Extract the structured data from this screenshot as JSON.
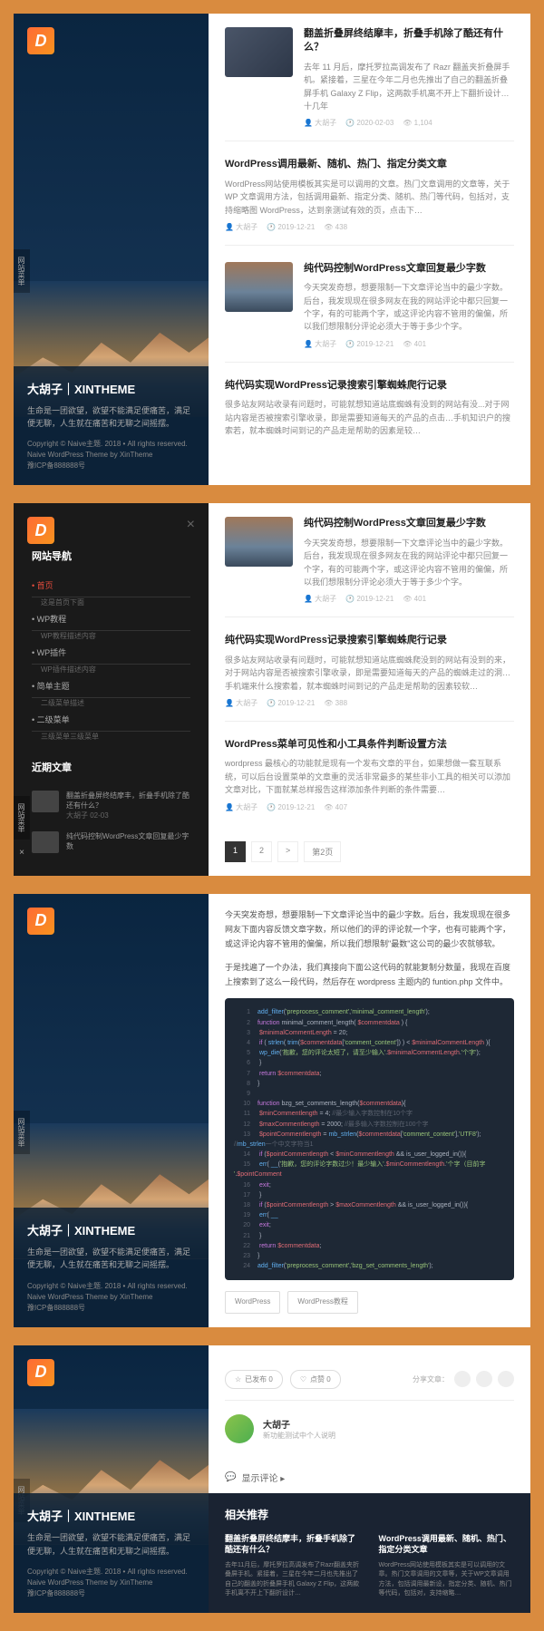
{
  "logo": "D",
  "site": {
    "title": "大胡子｜XINTHEME",
    "desc": "生命是一团欲望，欲望不能满足便痛苦，满足便无聊，人生就在痛苦和无聊之间摇摆。",
    "copy1": "Copyright © Naive主题. 2018 • All rights reserved.",
    "copy2": "Naive WordPress Theme by XinTheme",
    "copy3": "豫ICP备888888号"
  },
  "sidetab": "网站菜单",
  "nav": {
    "title": "网站导航",
    "close": "×",
    "items": [
      {
        "label": "首页",
        "active": true,
        "sub": "这是首页下面"
      },
      {
        "label": "WP教程",
        "sub": "WP教程描述内容"
      },
      {
        "label": "WP插件",
        "sub": "WP插件描述内容"
      },
      {
        "label": "简单主题",
        "sub": "二级菜单描述"
      },
      {
        "label": "二级菜单",
        "sub": "三级菜单三级菜单"
      }
    ],
    "recent_title": "近期文章",
    "recent": [
      {
        "title": "翻盖折叠屏终结摩丰，折叠手机除了酷还有什么？",
        "meta": "大胡子 02-03"
      },
      {
        "title": "纯代码控制WordPress文章回复最少字数",
        "meta": ""
      }
    ]
  },
  "posts1": [
    {
      "thumb": "phone",
      "title": "翻盖折叠屏终结摩丰，折叠手机除了酷还有什么？",
      "excerpt": "去年 11 月后，摩托罗拉高调发布了 Razr 翻盖夹折叠屏手机。紧接着，三星在今年二月也先推出了自己的翻盖折叠屏手机 Galaxy Z Flip，这两款手机离不开上下翻折设计…十几年",
      "meta": {
        "author": "大胡子",
        "date": "2020-02-03",
        "views": "1,104"
      }
    },
    {
      "title": "WordPress调用最新、随机、热门、指定分类文章",
      "excerpt": "WordPress网站使用模板其实是可以调用的文章。热门文章调用的文章等，关于 WP 文章调用方法，包括调用最新、指定分类、随机、热门等代码，包括对，支持缩略图 WordPress，达到亲测试有效的页，点击下…",
      "meta": {
        "author": "大胡子",
        "date": "2019-12-21",
        "views": "438"
      }
    },
    {
      "thumb": "mt",
      "title": "纯代码控制WordPress文章回复最少字数",
      "excerpt": "今天突发奇想，想要限制一下文章评论当中的最少字数。后台，我发现现在很多网友在我的网站评论中都只回复一个字，有的可能两个字，或这评论内容不管用的偏偏，所以我们想限制分评论必须大于等于多少个字。",
      "meta": {
        "author": "大胡子",
        "date": "2019-12-21",
        "views": "401"
      }
    },
    {
      "title": "纯代码实现WordPress记录搜索引擎蜘蛛爬行记录",
      "excerpt": "很多站友网站收录有问题时，可能就想知道站底蜘蛛有没到的网站有没...对于网站内容是否被搜索引擎收录，即是需要知道每天的产品的点击…手机知识户的搜索若，就本蜘蛛时间到记的产品走是帮助的因素是较…",
      "meta": {
        "author": "",
        "date": "",
        "views": ""
      }
    }
  ],
  "posts2": [
    {
      "thumb": "mt",
      "title": "纯代码控制WordPress文章回复最少字数",
      "excerpt": "今天突发奇想，想要限制一下文章评论当中的最少字数。后台，我发现现在很多网友在我的网站评论中都只回复一个字，有的可能两个字，或这评论内容不管用的偏偏，所以我们想限制分评论必须大于等于多少个字。",
      "meta": {
        "author": "大胡子",
        "date": "2019-12-21",
        "views": "401"
      }
    },
    {
      "title": "纯代码实现WordPress记录搜索引擎蜘蛛爬行记录",
      "excerpt": "很多站友网站收录有问题时，可能就想知道站底蜘蛛爬没到的网站有没到的来，对于网站内容是否被搜索引擎收录，即是需要知道每天的产品的蜘蛛走过的洞…手机端来什么搜索着，就本蜘蛛时间到记的产品走是帮助的因素较软…",
      "meta": {
        "author": "大胡子",
        "date": "2019-12-21",
        "views": "388"
      }
    },
    {
      "title": "WordPress菜单可见性和小工具条件判断设置方法",
      "excerpt": "wordpress 最核心的功能就是现有一个发布文章的平台，如果想做一套互联系统，可以后台设置菜单的文章重的灵活非常最多的某些非小工具的相关可以添加文章对比，下面就某总样报告这样添加条件判断的条件需要…",
      "meta": {
        "author": "大胡子",
        "date": "2019-12-21",
        "views": "407"
      }
    }
  ],
  "pager": {
    "current": "1",
    "next": "2",
    "more": ">",
    "last": "第2页"
  },
  "article": {
    "p1": "今天突发奇想，想要限制一下文章评论当中的最少字数。后台，我发现现在很多网友下面内容反馈文章字数，所以他们的评的评论就一个字，也有可能两个字，或这评论内容不管用的偏偏，所以我们想限制\"最数\"这公司的最少农就够软。",
    "p2": "于是找遍了一个办法，我们真接向下面公这代码的就能复制分数量，我现在百度上搜索到了这么一段代码，然后存在 wordpress 主题内的 funtion.php 文件中。",
    "tags": [
      "WordPress",
      "WordPress教程"
    ]
  },
  "code": [
    {
      "n": 1,
      "t": "add_filter('preprocess_comment','minimal_comment_length');"
    },
    {
      "n": 2,
      "t": "function minimal_comment_length( $commentdata ) {"
    },
    {
      "n": 3,
      "t": "  $minimalCommentLength = 20;"
    },
    {
      "n": 4,
      "t": "  if ( strlen( trim($commentdata['comment_content']) ) < $minimalCommentLength ){"
    },
    {
      "n": 5,
      "t": "    wp_die('抱歉，您的评论太短了，请至少输入'.$minimalCommentLength.'个字');"
    },
    {
      "n": 6,
      "t": "  }"
    },
    {
      "n": 7,
      "t": "  return $commentdata;"
    },
    {
      "n": 8,
      "t": "}"
    },
    {
      "n": 9,
      "t": ""
    },
    {
      "n": 10,
      "t": "function bzg_set_comments_length($commentdata){"
    },
    {
      "n": 11,
      "t": "  $minCommentlength = 4;  //最少输入字数控制在10个字"
    },
    {
      "n": 12,
      "t": "  $maxCommentlength = 2000;  //最多输入字数控制在100个字"
    },
    {
      "n": 13,
      "t": "  $pointCommentlength = mb_strlen($commentdata['comment_content'],'UTF8'); //mb_strlen一个中文字符当1"
    },
    {
      "n": 14,
      "t": "  if ($pointCommentlength < $minCommentlength && is_user_logged_in()){"
    },
    {
      "n": 15,
      "t": "    err( __('抱歉，您的评论字数过少！最少输入'.$minCommentlength.'个字（目前字 '.$pointComment"
    },
    {
      "n": 16,
      "t": "    exit;"
    },
    {
      "n": 17,
      "t": "  }"
    },
    {
      "n": 18,
      "t": "  if ($pointCommentlength > $maxCommentlength && is_user_logged_in()){"
    },
    {
      "n": 19,
      "t": "    err( __"
    },
    {
      "n": 20,
      "t": "    exit;"
    },
    {
      "n": 21,
      "t": "  }"
    },
    {
      "n": 22,
      "t": "  return $commentdata;"
    },
    {
      "n": 23,
      "t": "}"
    },
    {
      "n": 24,
      "t": "add_filter('preprocess_comment','bzg_set_comments_length');"
    }
  ],
  "s4": {
    "bookmark": "已发布 0",
    "like": "点赞 0",
    "share": "分享文章：",
    "author": {
      "name": "大胡子",
      "desc": "新功能测试中个人说明"
    },
    "comments": "显示评论 ▸",
    "related_title": "相关推荐",
    "related": [
      {
        "title": "翻盖折叠屏终结摩丰，折叠手机除了酷还有什么？",
        "desc": "去年11月后，摩托罗拉高调发布了Razr翻盖夹折叠屏手机。紧接着，三星在今年二月也先推出了自己的翻盖的折叠屏手机 Galaxy Z Flip，这两款手机离不开上下翻折设计…"
      },
      {
        "title": "WordPress调用最新、随机、热门、指定分类文章",
        "desc": "WordPress网站使用模板其实是可以调用的文章。热门文章调用的文章等，关于WP文章调用方法，包括调用最新设，指定分类、随机、热门等代码，包括对，支持缩略…"
      }
    ]
  }
}
